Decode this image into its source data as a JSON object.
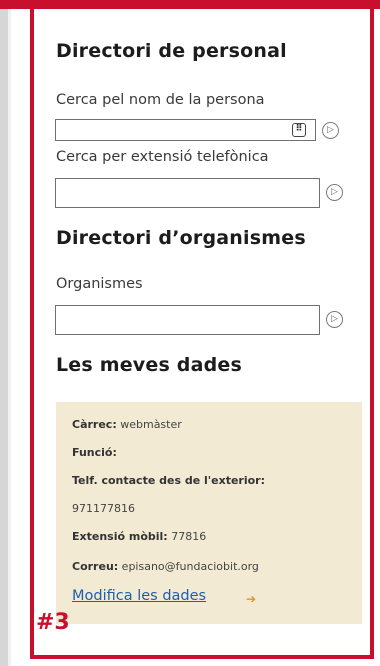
{
  "staff_directory": {
    "heading": "Directori de personal",
    "name_search_label": "Cerca pel nom de la persona",
    "name_search_value": "",
    "extension_search_label": "Cerca per extensió telefònica",
    "extension_search_value": ""
  },
  "organisation_directory": {
    "heading": "Directori d’organismes",
    "organisms_label": "Organismes",
    "organisms_value": ""
  },
  "my_data": {
    "heading": "Les meves dades",
    "position_label": "Càrrec:",
    "position_value": "webmàster",
    "function_label": "Funció:",
    "external_phone_label": "Telf. contacte des de l'exterior:",
    "external_phone_value": "971177816",
    "mobile_ext_label": "Extensió mòbil:",
    "mobile_ext_value": "77816",
    "email_label": "Correu:",
    "email_value": "episano@fundaciobit.org",
    "edit_link": "Modifica les dades"
  },
  "annotation_tag": "#3",
  "icons": {
    "go": "circle-chevron-right-icon",
    "keyboard": "keyboard-icon",
    "edit_arrow": "arrow-right-icon"
  },
  "colors": {
    "accent_red": "#c8102e",
    "link_blue": "#1d5fae",
    "box_bg": "#f3ead3",
    "arrow_orange": "#e79025"
  }
}
